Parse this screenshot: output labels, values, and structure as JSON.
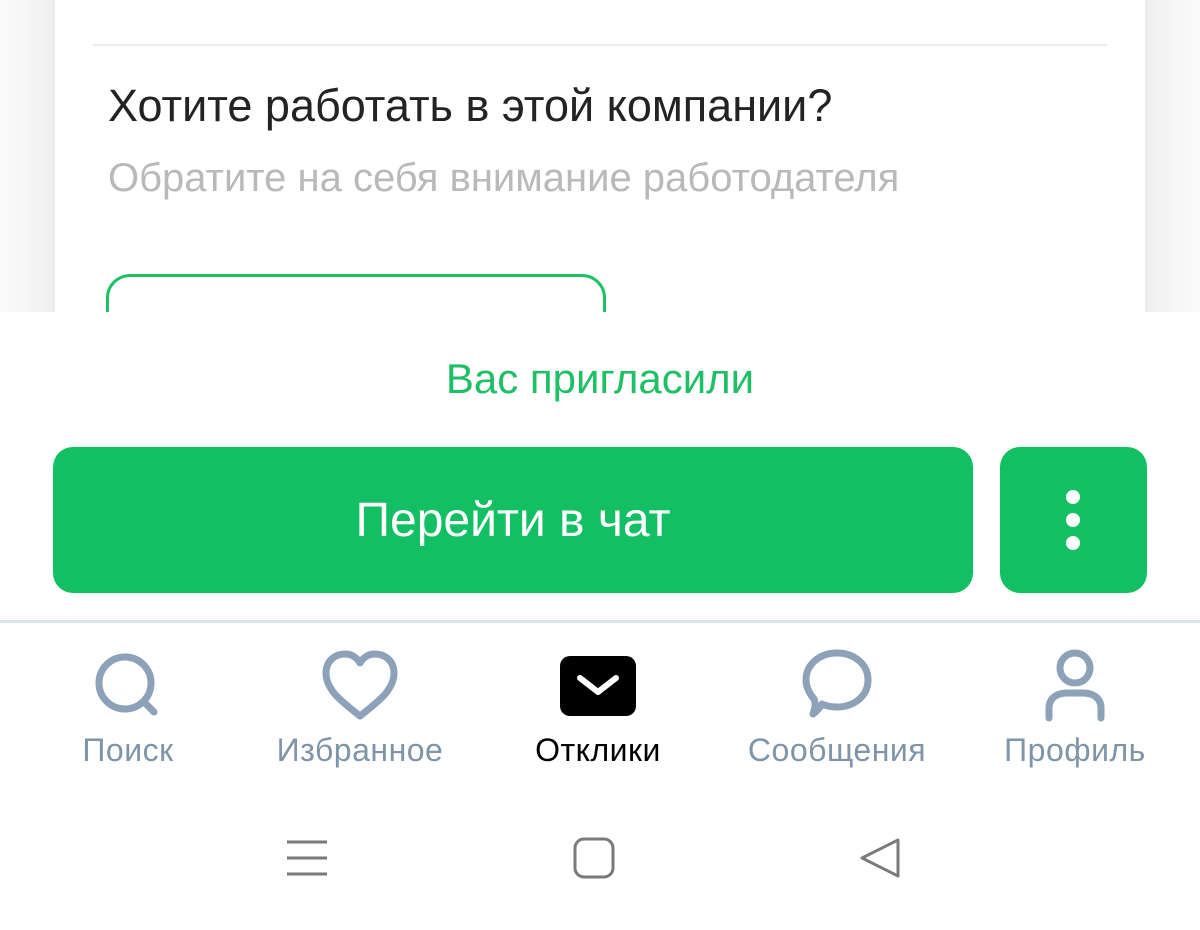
{
  "card": {
    "title": "Хотите работать в этой компании?",
    "subtitle": "Обратите на себя внимание работодателя"
  },
  "status": {
    "invited_label": "Вас пригласили"
  },
  "actions": {
    "chat_label": "Перейти в чат",
    "more_icon": "more-vertical-icon"
  },
  "colors": {
    "accent": "#12c063",
    "accent_text": "#1fbf66",
    "tab_inactive": "#7f93a9",
    "tab_active": "#000000"
  },
  "tabbar": {
    "items": [
      {
        "label": "Поиск",
        "icon": "search-icon",
        "active": false
      },
      {
        "label": "Избранное",
        "icon": "heart-icon",
        "active": false
      },
      {
        "label": "Отклики",
        "icon": "envelope-icon",
        "active": true
      },
      {
        "label": "Сообщения",
        "icon": "chat-bubble-icon",
        "active": false
      },
      {
        "label": "Профиль",
        "icon": "person-icon",
        "active": false
      }
    ]
  },
  "system_nav": {
    "items": [
      "menu-icon",
      "home-icon",
      "back-icon"
    ]
  }
}
